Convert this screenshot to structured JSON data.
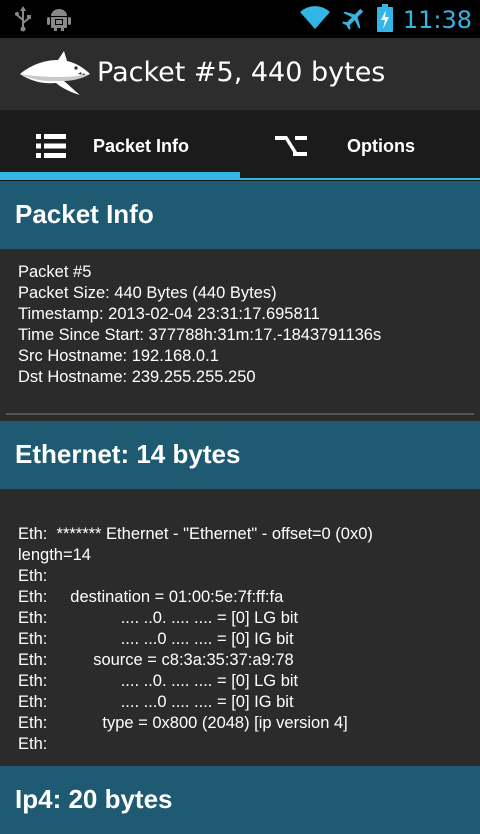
{
  "status_bar": {
    "icons": [
      "usb-icon",
      "android-debug-icon",
      "wifi-icon",
      "airplane-mode-icon",
      "battery-charging-icon"
    ],
    "time": "11:38",
    "accent": "#33b5e5"
  },
  "action_bar": {
    "title": "Packet #5, 440 bytes",
    "logo": "shark-logo"
  },
  "tabs": [
    {
      "label": "Packet Info",
      "icon": "list-icon",
      "selected": true
    },
    {
      "label": "Options",
      "icon": "options-switch-icon",
      "selected": false
    }
  ],
  "sections": {
    "packet_info": {
      "title": "Packet Info",
      "lines": [
        "Packet #5",
        "Packet Size: 440 Bytes (440 Bytes)",
        "Timestamp: 2013-02-04 23:31:17.695811",
        "Time Since Start: 377788h:31m:17.-1843791136s",
        "Src Hostname: 192.168.0.1",
        "Dst Hostname: 239.255.255.250"
      ]
    },
    "ethernet": {
      "title": "Ethernet: 14 bytes",
      "lines": [
        "Eth:  ******* Ethernet - \"Ethernet\" - offset=0 (0x0)",
        "length=14",
        "Eth:",
        "Eth:     destination = 01:00:5e:7f:ff:fa",
        "Eth:                .... ..0. .... .... = [0] LG bit",
        "Eth:                .... ...0 .... .... = [0] IG bit",
        "Eth:          source = c8:3a:35:37:a9:78",
        "Eth:                .... ..0. .... .... = [0] LG bit",
        "Eth:                .... ...0 .... .... = [0] IG bit",
        "Eth:            type = 0x800 (2048) [ip version 4]",
        "Eth:"
      ]
    },
    "ip4": {
      "title": "Ip4: 20 bytes"
    }
  },
  "colors": {
    "section_header": "#1e5b73",
    "background": "#2b2b2b",
    "tab_bar": "#1b1b1b"
  }
}
